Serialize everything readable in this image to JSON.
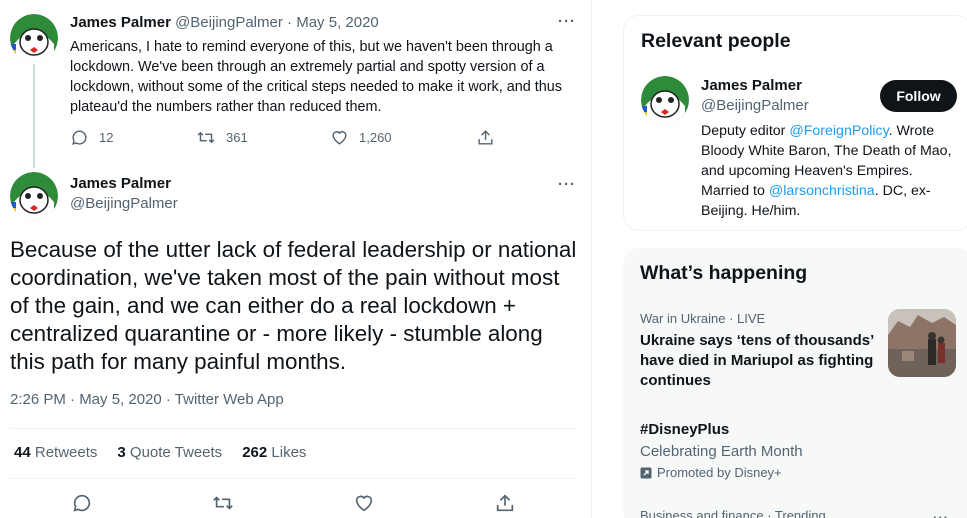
{
  "tweet1": {
    "author_name": "James Palmer",
    "author_handle": "@BeijingPalmer",
    "date": "May 5, 2020",
    "text": "Americans, I hate to remind everyone of this, but we haven't been through a lockdown. We've been through an extremely partial and spotty version of a lockdown, without some of the critical steps needed to make it work, and thus plateau'd the numbers rather than reduced them.",
    "replies": "12",
    "retweets": "361",
    "likes": "1,260",
    "more_icon": "more-icon"
  },
  "tweet2": {
    "author_name": "James Palmer",
    "author_handle": "@BeijingPalmer",
    "text": "Because of the utter lack of federal leadership or national coordination, we've taken most of the pain without most of the gain, and we can either do a real lockdown + centralized quarantine or - more likely - stumble along this path for many painful months.",
    "timestamp": "2:26 PM · May 5, 2020 · Twitter Web App",
    "stats": {
      "retweets_count": "44",
      "retweets_label": "Retweets",
      "quotes_count": "3",
      "quotes_label": "Quote Tweets",
      "likes_count": "262",
      "likes_label": "Likes"
    }
  },
  "relevant": {
    "title": "Relevant people",
    "name": "James Palmer",
    "handle": "@BeijingPalmer",
    "follow_label": "Follow",
    "bio_1": "Deputy editor ",
    "bio_link_1": "@ForeignPolicy",
    "bio_2": ". Wrote Bloody White Baron, The Death of Mao, and upcoming Heaven's Empires. Married to ",
    "bio_link_2": "@larsonchristina",
    "bio_3": ". DC, ex-Beijing. He/him."
  },
  "happening": {
    "title": "What’s happening",
    "trend1_meta": "War in Ukraine · LIVE",
    "trend1_title": "Ukraine says ‘tens of thousands’ have died in Mariupol as fighting continues",
    "trend2_title": "#DisneyPlus",
    "trend2_sub": "Celebrating Earth Month",
    "trend2_promo": "Promoted by Disney+",
    "trend3_meta": "Business and finance · Trending"
  },
  "colors": {
    "accent": "#1d9bf0",
    "text": "#0f1419",
    "muted": "#536471"
  }
}
